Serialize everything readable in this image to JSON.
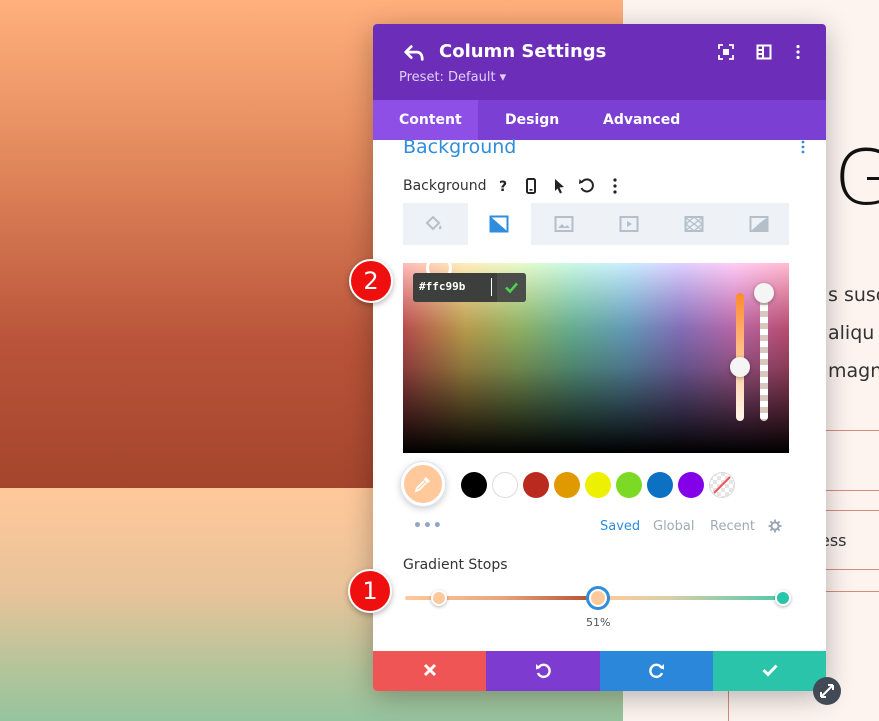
{
  "background_page": {
    "heading": "G",
    "lines": [
      "s susc",
      "aliqu",
      "magn"
    ],
    "small_text": "ess"
  },
  "panel": {
    "title": "Column Settings",
    "preset_label": "Preset: Default ▾",
    "tabs": [
      {
        "label": "Content",
        "active": true
      },
      {
        "label": "Design",
        "active": false
      },
      {
        "label": "Advanced",
        "active": false
      }
    ],
    "section_title": "Background",
    "background_label": "Background",
    "background_types": [
      "color",
      "gradient",
      "image",
      "video",
      "pattern",
      "mask"
    ],
    "active_background_type": "gradient"
  },
  "color_picker": {
    "hex_value": "#ffc99b",
    "current_color": "#ffc99b",
    "swatches": [
      "#000000",
      "#ffffff",
      "#bb2a1e",
      "#e09900",
      "#edf000",
      "#7cda24",
      "#0c71c3",
      "#8300e9",
      "none"
    ],
    "library_tabs": [
      {
        "label": "Saved",
        "active": true
      },
      {
        "label": "Global",
        "active": false
      },
      {
        "label": "Recent",
        "active": false
      }
    ]
  },
  "gradient_stops": {
    "label": "Gradient Stops",
    "stops": [
      {
        "color": "#ffc99b",
        "position_percent": 9
      },
      {
        "color": "#ffc99b",
        "position_percent": 51,
        "active": true
      },
      {
        "color": "#29c4a9",
        "position_percent": 100
      }
    ],
    "active_percent_label": "51%"
  },
  "callouts": [
    "1",
    "2"
  ],
  "colors": {
    "header": "#6c2eb9",
    "tabs": "#7b3fd3",
    "accent": "#2e8ddd",
    "cancel": "#ef5555",
    "undo": "#7e3bd0",
    "redo": "#2b87da",
    "save": "#29c4a9"
  }
}
